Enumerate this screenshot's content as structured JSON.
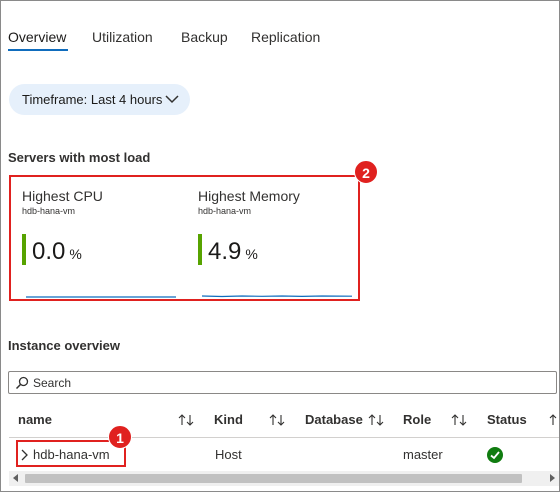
{
  "tabs": [
    {
      "label": "Overview",
      "active": true
    },
    {
      "label": "Utilization",
      "active": false
    },
    {
      "label": "Backup",
      "active": false
    },
    {
      "label": "Replication",
      "active": false
    }
  ],
  "timeframe": {
    "label": "Timeframe: Last 4 hours",
    "icon": "chevron-down-icon"
  },
  "servers_section": {
    "title": "Servers with most load",
    "badge": "2",
    "metrics": [
      {
        "title": "Highest CPU",
        "server": "hdb-hana-vm",
        "value": "0.0",
        "unit": "%",
        "bar_color": "#57a300"
      },
      {
        "title": "Highest Memory",
        "server": "hdb-hana-vm",
        "value": "4.9",
        "unit": "%",
        "bar_color": "#57a300"
      }
    ]
  },
  "instance_section": {
    "title": "Instance overview",
    "search_placeholder": "Search",
    "columns": [
      "name",
      "Kind",
      "Database",
      "Role",
      "Status"
    ],
    "rows": [
      {
        "name": "hdb-hana-vm",
        "kind": "Host",
        "database": "",
        "role": "master",
        "status": "healthy"
      }
    ],
    "badge": "1"
  },
  "colors": {
    "accent": "#0f6cbd",
    "highlight": "#e0211f",
    "ok": "#107c10",
    "metric_bar": "#57a300"
  }
}
